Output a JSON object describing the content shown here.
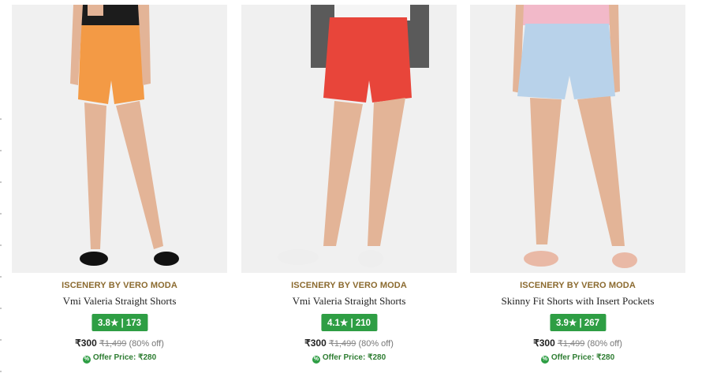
{
  "products": [
    {
      "brand": "ISCENERY BY VERO MODA",
      "name": "Vmi Valeria Straight Shorts",
      "rating": "3.8★ | 173",
      "price": "₹300",
      "mrp": "₹1,499",
      "discount": "(80% off)",
      "offer_price": "Offer Price: ₹280",
      "shorts_color": "#f39a45",
      "top_color": "#1c1c1c",
      "shoe_color": "#111111"
    },
    {
      "brand": "ISCENERY BY VERO MODA",
      "name": "Vmi Valeria Straight Shorts",
      "rating": "4.1★ | 210",
      "price": "₹300",
      "mrp": "₹1,499",
      "discount": "(80% off)",
      "offer_price": "Offer Price: ₹280",
      "shorts_color": "#e8453a",
      "top_color": "#5a5a5a",
      "shoe_color": "#eeeeee"
    },
    {
      "brand": "ISCENERY BY VERO MODA",
      "name": "Skinny Fit Shorts with Insert Pockets",
      "rating": "3.9★ | 267",
      "price": "₹300",
      "mrp": "₹1,499",
      "discount": "(80% off)",
      "offer_price": "Offer Price: ₹280",
      "shorts_color": "#b8d2ea",
      "top_color": "#f2b9c9",
      "shoe_color": "#e9b9a6"
    }
  ],
  "colors": {
    "rating_badge": "#2e9e44",
    "brand_text": "#8b6a2f",
    "offer_text": "#2e7d32"
  }
}
